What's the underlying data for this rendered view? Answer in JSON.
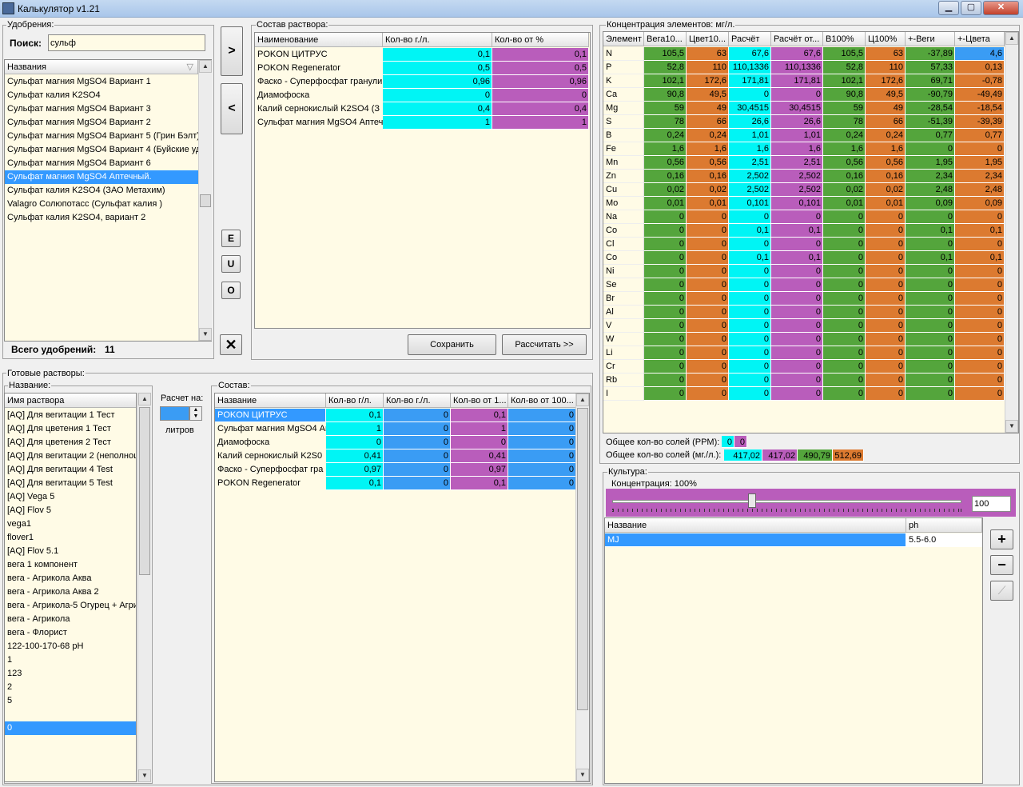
{
  "window": {
    "title": "Калькулятор v1.21"
  },
  "fertilizers": {
    "legend": "Удобрения:",
    "search_label": "Поиск:",
    "search_value": "сульф",
    "column": "Названия",
    "items": [
      "Сульфат магния MgSO4 Вариант 1",
      "Сульфат калия K2SO4",
      "Сульфат магния MgSO4 Вариант 3",
      "Сульфат магния MgSO4 Вариант 2",
      "Сульфат магния MgSO4 Вариант 5 (Грин Бэлт)",
      "Сульфат магния MgSO4 Вариант 4 (Буйские уд",
      "Сульфат магния MgSO4 Вариант 6",
      "Сульфат магния MgSO4 Аптечный.",
      "Сульфат калия K2SO4 (ЗАО Метахим)",
      "Valagro Солюпотасс (Сульфат калия )",
      "Сульфат калия K2SO4, вариант 2"
    ],
    "selected_index": 7,
    "total_label": "Всего удобрений:",
    "total_value": "11"
  },
  "middle_buttons": {
    "add": ">",
    "remove": "<",
    "e": "E",
    "u": "U",
    "o": "O",
    "clear": "✕"
  },
  "composition": {
    "legend": "Состав раствора:",
    "headers": [
      "Наименование",
      "Кол-во г./л.",
      "Кол-во от %"
    ],
    "rows": [
      [
        "POKON ЦИТРУС",
        "0,1",
        "0,1"
      ],
      [
        "POKON Regenerator",
        "0,5",
        "0,5"
      ],
      [
        "Фаско - Суперфосфат гранули",
        "0,96",
        "0,96"
      ],
      [
        "Диамофоска",
        "0",
        "0"
      ],
      [
        "Калий сернокислый K2SO4 (З",
        "0,4",
        "0,4"
      ],
      [
        "Сульфат магния MgSO4 Аптечн",
        "1",
        "1"
      ]
    ],
    "save_label": "Сохранить",
    "calc_label": "Рассчитать >>"
  },
  "concentration": {
    "legend": "Концентрация элементов: мг/л.",
    "headers": [
      "Элемент",
      "Вега10...",
      "Цвет10...",
      "Расчёт",
      "Расчёт от...",
      "В100%",
      "Ц100%",
      "+-Веги",
      "+-Цвета"
    ],
    "rows": [
      [
        "N",
        "105,5",
        "63",
        "67,6",
        "67,6",
        "105,5",
        "63",
        "-37,89",
        "4,6"
      ],
      [
        "P",
        "52,8",
        "110",
        "110,1336",
        "110,1336",
        "52,8",
        "110",
        "57,33",
        "0,13"
      ],
      [
        "K",
        "102,1",
        "172,6",
        "171,81",
        "171,81",
        "102,1",
        "172,6",
        "69,71",
        "-0,78"
      ],
      [
        "Ca",
        "90,8",
        "49,5",
        "0",
        "0",
        "90,8",
        "49,5",
        "-90,79",
        "-49,49"
      ],
      [
        "Mg",
        "59",
        "49",
        "30,4515",
        "30,4515",
        "59",
        "49",
        "-28,54",
        "-18,54"
      ],
      [
        "S",
        "78",
        "66",
        "26,6",
        "26,6",
        "78",
        "66",
        "-51,39",
        "-39,39"
      ],
      [
        "B",
        "0,24",
        "0,24",
        "1,01",
        "1,01",
        "0,24",
        "0,24",
        "0,77",
        "0,77"
      ],
      [
        "Fe",
        "1,6",
        "1,6",
        "1,6",
        "1,6",
        "1,6",
        "1,6",
        "0",
        "0"
      ],
      [
        "Mn",
        "0,56",
        "0,56",
        "2,51",
        "2,51",
        "0,56",
        "0,56",
        "1,95",
        "1,95"
      ],
      [
        "Zn",
        "0,16",
        "0,16",
        "2,502",
        "2,502",
        "0,16",
        "0,16",
        "2,34",
        "2,34"
      ],
      [
        "Cu",
        "0,02",
        "0,02",
        "2,502",
        "2,502",
        "0,02",
        "0,02",
        "2,48",
        "2,48"
      ],
      [
        "Mo",
        "0,01",
        "0,01",
        "0,101",
        "0,101",
        "0,01",
        "0,01",
        "0,09",
        "0,09"
      ],
      [
        "Na",
        "0",
        "0",
        "0",
        "0",
        "0",
        "0",
        "0",
        "0"
      ],
      [
        "Co",
        "0",
        "0",
        "0,1",
        "0,1",
        "0",
        "0",
        "0,1",
        "0,1"
      ],
      [
        "Cl",
        "0",
        "0",
        "0",
        "0",
        "0",
        "0",
        "0",
        "0"
      ],
      [
        "Co",
        "0",
        "0",
        "0,1",
        "0,1",
        "0",
        "0",
        "0,1",
        "0,1"
      ],
      [
        "Ni",
        "0",
        "0",
        "0",
        "0",
        "0",
        "0",
        "0",
        "0"
      ],
      [
        "Se",
        "0",
        "0",
        "0",
        "0",
        "0",
        "0",
        "0",
        "0"
      ],
      [
        "Br",
        "0",
        "0",
        "0",
        "0",
        "0",
        "0",
        "0",
        "0"
      ],
      [
        "Al",
        "0",
        "0",
        "0",
        "0",
        "0",
        "0",
        "0",
        "0"
      ],
      [
        "V",
        "0",
        "0",
        "0",
        "0",
        "0",
        "0",
        "0",
        "0"
      ],
      [
        "W",
        "0",
        "0",
        "0",
        "0",
        "0",
        "0",
        "0",
        "0"
      ],
      [
        "Li",
        "0",
        "0",
        "0",
        "0",
        "0",
        "0",
        "0",
        "0"
      ],
      [
        "Cr",
        "0",
        "0",
        "0",
        "0",
        "0",
        "0",
        "0",
        "0"
      ],
      [
        "Rb",
        "0",
        "0",
        "0",
        "0",
        "0",
        "0",
        "0",
        "0"
      ],
      [
        "I",
        "0",
        "0",
        "0",
        "0",
        "0",
        "0",
        "0",
        "0"
      ]
    ],
    "ppm_label": "Общее кол-во солей (PPM):",
    "ppm_values": [
      "0",
      "0"
    ],
    "mgl_label": "Общее кол-во солей (мг./л.):",
    "mgl_values": [
      "417,02",
      "417,02",
      "490,79",
      "512,69"
    ]
  },
  "ready": {
    "legend": "Готовые растворы:",
    "name_legend": "Название:",
    "column": "Имя раствора",
    "items": [
      "[AQ] Для вегитации 1 Тест",
      "[AQ] Для цветения 1 Тест",
      "[AQ] Для цветения 2 Тест",
      "[AQ] Для вегитации 2 (неполноц",
      "[AQ] Для вегитации 4 Test",
      "[AQ] Для вегитации 5 Test",
      "[AQ] Vega 5",
      "[AQ] Flov 5",
      "vega1",
      "flover1",
      "[AQ] Flov 5.1",
      "вега 1 компонент",
      "вега - Агрикола Аква",
      "вега - Агрикола Аква 2",
      "вега - Агрикола-5 Огурец + Агри",
      "вега - Агрикола",
      "вега - Флорист",
      "122-100-170-68 pH",
      "1",
      "123",
      "2",
      "5",
      "",
      "0"
    ],
    "selected_index": 23,
    "calc_label": "Расчет на:",
    "calc_value": "",
    "liters_label": "литров"
  },
  "sostav": {
    "legend": "Состав:",
    "headers": [
      "Название",
      "Кол-во г/л.",
      "Кол-во г./л.",
      "Кол-во от 1...",
      "Кол-во от 100..."
    ],
    "rows": [
      [
        "POKON ЦИТРУС",
        "0,1",
        "0",
        "0,1",
        "0"
      ],
      [
        "Сульфат магния MgSO4 Ап",
        "1",
        "0",
        "1",
        "0"
      ],
      [
        "Диамофоска",
        "0",
        "0",
        "0",
        "0"
      ],
      [
        "Калий сернокислый K2S0",
        "0,41",
        "0",
        "0,41",
        "0"
      ],
      [
        "Фаско - Суперфосфат гра",
        "0,97",
        "0",
        "0,97",
        "0"
      ],
      [
        "POKON Regenerator",
        "0,1",
        "0",
        "0,1",
        "0"
      ]
    ]
  },
  "culture": {
    "legend": "Культура:",
    "conc_label": "Концентрация: 100%",
    "slider_level_percent": 100,
    "value": "100",
    "headers": [
      "Название",
      "ph"
    ],
    "rows": [
      [
        "MJ",
        "5.5-6.0"
      ]
    ],
    "plus": "+",
    "minus": "−",
    "chart": "⟋"
  },
  "colors": {
    "green": "#54a53c",
    "orange": "#dc7a30",
    "cyan": "#00f5f5",
    "purple": "#b95dbb",
    "blue": "#3a9cf4"
  }
}
